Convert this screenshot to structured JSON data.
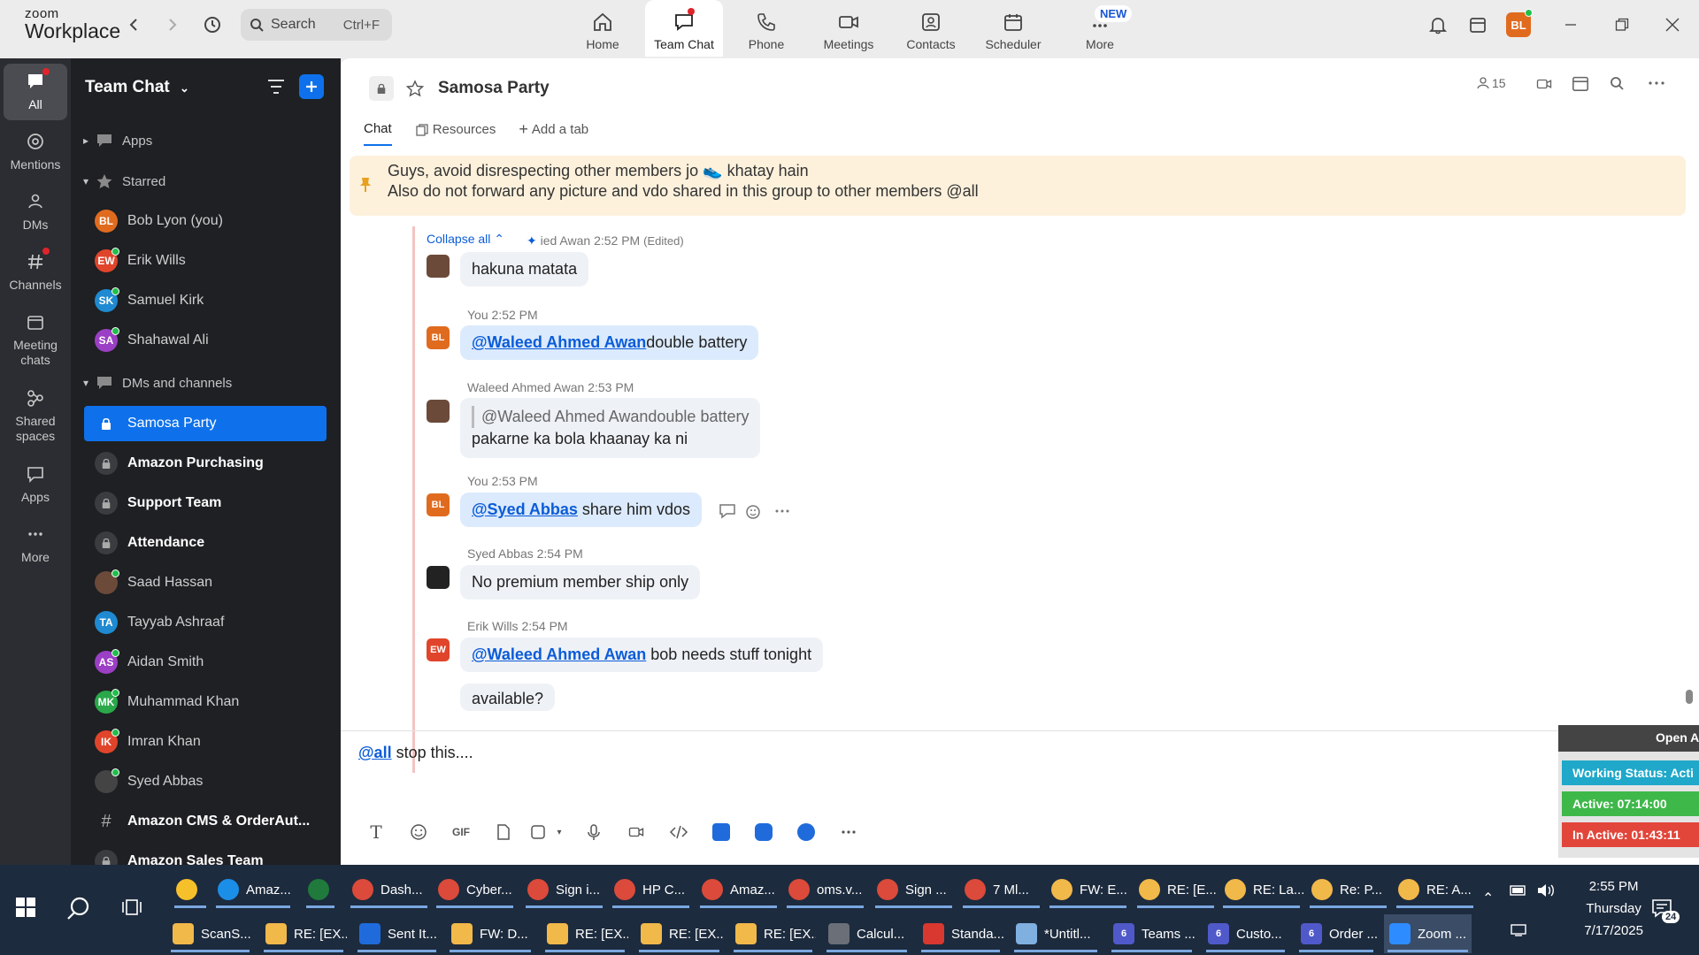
{
  "app": {
    "logo_line1": "zoom",
    "logo_line2": "Workplace"
  },
  "search": {
    "placeholder": "Search",
    "shortcut": "Ctrl+F"
  },
  "topnav": [
    {
      "label": "Home",
      "icon": "home-icon"
    },
    {
      "label": "Team Chat",
      "icon": "chat-icon"
    },
    {
      "label": "Phone",
      "icon": "phone-icon"
    },
    {
      "label": "Meetings",
      "icon": "video-icon"
    },
    {
      "label": "Contacts",
      "icon": "contacts-icon"
    },
    {
      "label": "Scheduler",
      "icon": "scheduler-icon"
    },
    {
      "label": "More",
      "icon": "more-icon",
      "badge": "NEW"
    }
  ],
  "user": {
    "initials": "BL",
    "color": "#e06b1f"
  },
  "rail": [
    {
      "label": "All"
    },
    {
      "label": "Mentions"
    },
    {
      "label": "DMs"
    },
    {
      "label": "Channels"
    },
    {
      "label1": "Meeting",
      "label2": "chats"
    },
    {
      "label1": "Shared",
      "label2": "spaces"
    },
    {
      "label": "Apps"
    },
    {
      "label": "More"
    }
  ],
  "sidebar": {
    "title": "Team Chat",
    "apps_label": "Apps",
    "starred_label": "Starred",
    "dms_label": "DMs and channels",
    "starred": [
      {
        "name": "Bob Lyon (you)",
        "initials": "BL",
        "color": "#e06b1f"
      },
      {
        "name": "Erik Wills",
        "initials": "EW",
        "color": "#e0452b"
      },
      {
        "name": "Samuel Kirk",
        "initials": "SK",
        "color": "#1f8ad1"
      },
      {
        "name": "Shahawal Ali",
        "initials": "SA",
        "color": "#9b3fc4"
      }
    ],
    "channels": [
      {
        "name": "Samosa Party"
      },
      {
        "name": "Amazon Purchasing"
      },
      {
        "name": "Support Team"
      },
      {
        "name": "Attendance"
      }
    ],
    "contacts": [
      {
        "name": "Saad Hassan",
        "initials": "",
        "color": "#6b4a3a"
      },
      {
        "name": "Tayyab Ashraaf",
        "initials": "TA",
        "color": "#1f8ad1"
      },
      {
        "name": "Aidan Smith",
        "initials": "AS",
        "color": "#9b3fc4"
      },
      {
        "name": "Muhammad Khan",
        "initials": "MK",
        "color": "#2aa84a"
      },
      {
        "name": "Imran Khan",
        "initials": "IK",
        "color": "#e0452b"
      },
      {
        "name": "Syed Abbas",
        "initials": "",
        "color": "#444"
      }
    ],
    "more_channels": [
      {
        "name": "Amazon CMS & OrderAut..."
      },
      {
        "name": "Amazon Sales Team"
      }
    ]
  },
  "channel": {
    "title": "Samosa Party",
    "member_count": "15",
    "tabs": [
      "Chat",
      "Resources",
      "Add a tab"
    ],
    "pinned_line1": "Guys, avoid disrespecting other members jo 👟 khatay hain",
    "pinned_line2": "Also do not forward any picture and vdo shared in this group to other members @all"
  },
  "messages": {
    "collapse_label": "Collapse all",
    "m1_meta": "ied Awan 2:52 PM",
    "m1_edited": "(Edited)",
    "m1_text": "hakuna matata",
    "m2_sender": "You",
    "m2_time": "2:52 PM",
    "m2_mention": "@Waleed Ahmed Awan",
    "m2_text": "double battery",
    "m3_sender": "Waleed Ahmed Awan",
    "m3_time": "2:53 PM",
    "m3_quote": "@Waleed Ahmed Awandouble battery",
    "m3_text": "pakarne ka bola khaanay ka ni",
    "m4_sender": "You",
    "m4_time": "2:53 PM",
    "m4_mention": "@Syed Abbas",
    "m4_text": " share him vdos",
    "m5_sender": "Syed Abbas",
    "m5_time": "2:54 PM",
    "m5_text": "No premium member ship only",
    "m6_sender": "Erik Wills",
    "m6_time": "2:54 PM",
    "m6_mention": "@Waleed Ahmed Awan",
    "m6_text": " bob needs stuff tonight",
    "m7_text": "available?",
    "you_initials": "BL",
    "erik_initials": "EW"
  },
  "composer": {
    "mention": "@all",
    "text": " stop this...."
  },
  "overlay": {
    "open_label": "Open A",
    "working_status": "Working Status: Acti",
    "active": "Active: 07:14:00",
    "inactive": "In Active: 01:43:11"
  },
  "taskbar": {
    "row1": [
      "",
      "Amaz...",
      "",
      "Dash...",
      "Cyber...",
      "Sign i...",
      "HP C...",
      "Amaz...",
      "oms.v...",
      "Sign ...",
      "7 Ml...",
      "FW: E...",
      "RE: [E...",
      "RE: La...",
      "Re: P...",
      "RE: A..."
    ],
    "row2": [
      "ScanS...",
      "RE: [EX...",
      "Sent It...",
      "FW: D...",
      "RE: [EX...",
      "RE: [EX...",
      "RE: [EX...",
      "Calcul...",
      "Standa...",
      "*Untitl...",
      "Teams ...",
      "Custo...",
      "Order ...",
      "Zoom ..."
    ],
    "time": "2:55 PM",
    "day": "Thursday",
    "date": "7/17/2025",
    "notif_count": "24",
    "badge_6": "6"
  }
}
